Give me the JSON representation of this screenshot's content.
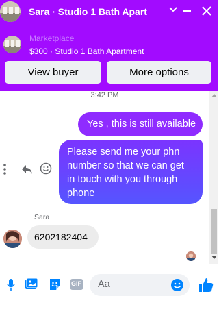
{
  "header": {
    "title": "Sara · Studio 1 Bath Apart",
    "chevron_icon": "chevron-down-icon",
    "minimize_icon": "minimize-icon",
    "close_icon": "close-icon"
  },
  "marketplace": {
    "label": "Marketplace",
    "listing": "$300 · Studio 1 Bath Apartment",
    "view_buyer": "View buyer",
    "more_options": "More options"
  },
  "chat": {
    "timestamp": "3:42 PM",
    "messages": [
      {
        "from": "me",
        "text": "Yes , this is still available"
      },
      {
        "from": "me",
        "text": "Please send me your phn number so that we can get in touch with you through phone"
      },
      {
        "from": "Sara",
        "text": "6202182404"
      }
    ],
    "sender_name": "Sara"
  },
  "composer": {
    "placeholder": "Aa",
    "icons": [
      "microphone-icon",
      "photo-icon",
      "sticker-icon",
      "gif-icon",
      "emoji-icon",
      "thumbs-up-icon"
    ],
    "gif_label": "GIF"
  },
  "colors": {
    "brand": "#a20bff",
    "bubble_me": "#8f2bff",
    "bubble_gradient_end": "#5555ff",
    "accent_blue": "#0084ff"
  }
}
